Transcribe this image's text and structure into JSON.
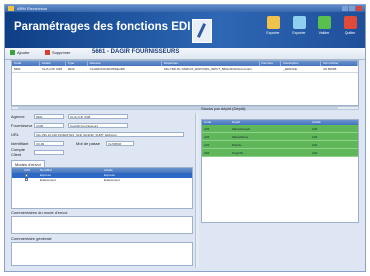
{
  "window": {
    "title": "ARM Electrónica"
  },
  "banner": {
    "title": "Paramétrages des fonctions EDI",
    "toolbar": [
      {
        "label": "Exporter",
        "icon": "export-icon",
        "color": "#f0c24b"
      },
      {
        "label": "Exporter",
        "icon": "export-all-icon",
        "color": "#8fd0f0"
      },
      {
        "label": "Valider",
        "icon": "check-icon",
        "color": "#59c04f"
      },
      {
        "label": "Quitter",
        "icon": "close-icon",
        "color": "#e04a3a"
      }
    ]
  },
  "subbar": {
    "add_label": "Ajouter",
    "delete_label": "Supprimer",
    "heading": "5661 - DAGIR FOURNISSEURS"
  },
  "grid1": {
    "columns": [
      "Code",
      "Libellé",
      "Type",
      "Adresse",
      "Répertoire",
      "Dernière",
      "Description",
      "Nom fichier"
    ],
    "rows": [
      [
        "5661",
        "CL/A.O.B. 6/48",
        "0043",
        "CL/ARF/FOURNISSEURS",
        "MG-TR8 15 / 6M/FOX_EXP/CIRG_INPUT_5661/AF\\fichiers.fourni",
        "",
        "_EDIFICE",
        "A5 5661B"
      ]
    ]
  },
  "fields": {
    "agence_label": "Agence",
    "agence_code": "5661",
    "agence_value": "CL/A.O.B. 6/48",
    "fournisseur_label": "Fournisseur",
    "fournisseur_code": "C005",
    "fournisseur_value": "Cart/All Fournisseurs",
    "url_label": "URL",
    "url_value": "http://96.10.128.15/JEDITES_SFR_EDI/NR_SUPP_EDI/arcs.",
    "identifiant_label": "Identifiant",
    "identifiant_value": "C0-69",
    "mdp_label": "Mot de passe",
    "mdp_value": "Xe7#8N9!",
    "compte_label": "Compte Client"
  },
  "tabs": [
    "Modes d'envoi"
  ],
  "grid2": {
    "columns": [
      "",
      "Actif",
      "Nom/Rel",
      "Libellé"
    ],
    "rows": [
      [
        "Express",
        "Express"
      ],
      [
        "Enlèvement",
        "Enlèvement"
      ]
    ]
  },
  "sections": {
    "comment_mode_label": "Commentaires du mode d'envoi",
    "comment_general_label": "Commentaire générale"
  },
  "right": {
    "title": "Stocks par dépôt (Dépôt)",
    "columns": [
      "Code",
      "Dépôt",
      "Libellé"
    ],
    "rows": [
      [
        "A03",
        "Maris/Accueil",
        "A03"
      ],
      [
        "A04",
        "Marseillères",
        "A04"
      ],
      [
        "A01",
        "Paris/L...",
        "A01"
      ],
      [
        "A02",
        "Pu/gr/N/...",
        "A02"
      ]
    ]
  }
}
